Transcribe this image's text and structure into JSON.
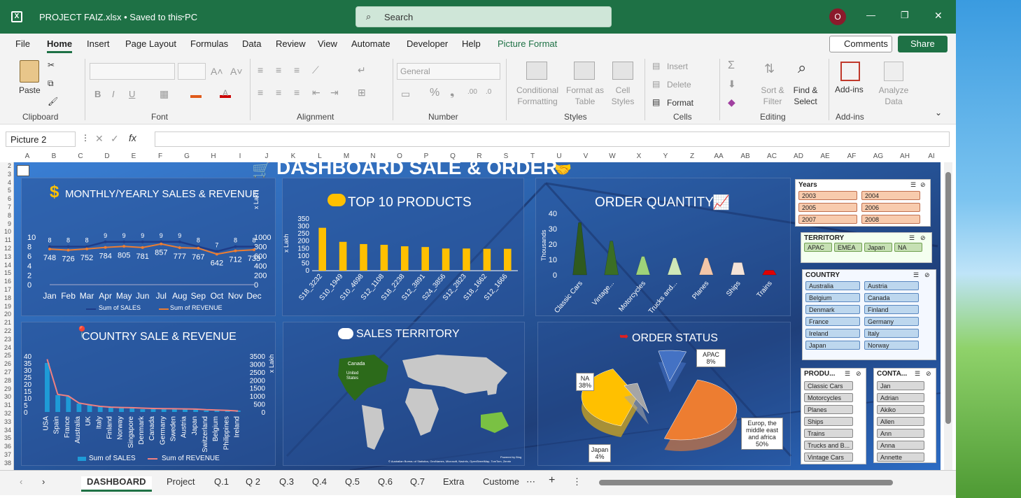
{
  "window": {
    "title": "PROJECT FAIZ.xlsx  •  Saved to this PC",
    "search_placeholder": "Search",
    "avatar": "O",
    "minimize": "—",
    "restore": "❐",
    "close": "✕"
  },
  "menu": [
    "File",
    "Home",
    "Insert",
    "Page Layout",
    "Formulas",
    "Data",
    "Review",
    "View",
    "Automate",
    "Developer",
    "Help",
    "Picture Format"
  ],
  "menu_right": {
    "comments": "Comments",
    "share": "Share"
  },
  "ribbon": {
    "clipboard": {
      "paste": "Paste",
      "group": "Clipboard"
    },
    "font": {
      "group": "Font",
      "bold": "B",
      "italic": "I",
      "underline": "U"
    },
    "alignment": {
      "group": "Alignment"
    },
    "number": {
      "group": "Number",
      "format": "General",
      "percent": "%"
    },
    "styles": {
      "group": "Styles",
      "conditional": "Conditional Formatting",
      "format_as": "Format as Table",
      "cell_styles": "Cell Styles"
    },
    "cells": {
      "group": "Cells",
      "insert": "Insert",
      "delete": "Delete",
      "format": "Format"
    },
    "editing": {
      "group": "Editing",
      "sort": "Sort & Filter",
      "find": "Find & Select"
    },
    "addins": {
      "group": "Add-ins",
      "addins": "Add-ins",
      "analyze": "Analyze Data"
    }
  },
  "formula_bar": {
    "name_box": "Picture 2",
    "fx": "fx"
  },
  "columns": [
    "A",
    "B",
    "C",
    "D",
    "E",
    "F",
    "G",
    "H",
    "I",
    "J",
    "K",
    "L",
    "M",
    "N",
    "O",
    "P",
    "Q",
    "R",
    "S",
    "T",
    "U",
    "V",
    "W",
    "X",
    "Y",
    "Z",
    "AA",
    "AB",
    "AC",
    "AD",
    "AE",
    "AF",
    "AG",
    "AH",
    "AI"
  ],
  "rows": [
    "2",
    "3",
    "4",
    "5",
    "6",
    "7",
    "8",
    "9",
    "10",
    "11",
    "12",
    "13",
    "14",
    "15",
    "16",
    "17",
    "18",
    "19",
    "20",
    "21",
    "22",
    "23",
    "24",
    "25",
    "26",
    "27",
    "28",
    "29",
    "30",
    "31",
    "32",
    "33",
    "34",
    "35",
    "36",
    "37",
    "38"
  ],
  "dashboard": {
    "title": "DASHBOARD SALE & ORDER",
    "monthly": {
      "title": "MONTHLY/YEARLY SALES & REVENUE",
      "unit": "x Lakh",
      "legend_sales": "Sum of SALES",
      "legend_revenue": "Sum of REVENUE",
      "left_ticks": [
        "10",
        "8",
        "6",
        "4",
        "2",
        "0"
      ],
      "right_ticks": [
        "1000",
        "800",
        "600",
        "400",
        "200",
        "0"
      ]
    },
    "top10": {
      "title": "TOP 10 PRODUCTS",
      "unit": "x Lakh",
      "ticks": [
        "350",
        "300",
        "250",
        "200",
        "150",
        "100",
        "50",
        "0"
      ]
    },
    "order_qty": {
      "title": "ORDER QUANTITY",
      "unit": "Thousands",
      "ticks": [
        "40",
        "30",
        "20",
        "10",
        "0"
      ]
    },
    "country": {
      "title": "COUNTRY SALE & REVENUE",
      "unit": "x Lakh",
      "legend_sales": "Sum of SALES",
      "legend_revenue": "Sum of REVENUE",
      "left_ticks": [
        "40",
        "35",
        "30",
        "25",
        "20",
        "15",
        "10",
        "5",
        "0"
      ],
      "right_ticks": [
        "3500",
        "3000",
        "2500",
        "2000",
        "1500",
        "1000",
        "500",
        "0"
      ]
    },
    "territory": {
      "title": "SALES TERRITORY",
      "map_label_canada": "Canada",
      "map_label_us": "United States",
      "credit": "© Australian Bureau of Statistics, GeoNames, Microsoft, Navinfo, OpenStreetMap, TomTom, Zenrin",
      "powered": "Powered by Bing"
    },
    "order_status": {
      "title": "ORDER STATUS"
    }
  },
  "chart_data": [
    {
      "type": "line",
      "title": "MONTHLY/YEARLY SALES & REVENUE",
      "categories": [
        "Jan",
        "Feb",
        "Mar",
        "Apr",
        "May",
        "Jun",
        "Jul",
        "Aug",
        "Sep",
        "Oct",
        "Nov",
        "Dec"
      ],
      "series": [
        {
          "name": "Sum of SALES",
          "values": [
            8,
            8,
            8,
            9,
            9,
            9,
            9,
            9,
            8,
            7,
            8,
            8
          ]
        },
        {
          "name": "Sum of REVENUE",
          "values": [
            748,
            726,
            752,
            784,
            805,
            781,
            857,
            777,
            767,
            642,
            712,
            733
          ]
        }
      ],
      "ylabel": "x Lakh",
      "ylim": [
        0,
        10
      ],
      "y2lim": [
        0,
        1000
      ],
      "legend": "bottom"
    },
    {
      "type": "bar",
      "title": "TOP 10 PRODUCTS",
      "categories": [
        "S18_3232",
        "S10_1949",
        "S10_4698",
        "S12_1108",
        "S18_2238",
        "S12_3891",
        "S24_3856",
        "S12_2823",
        "S18_1662",
        "S12_1666"
      ],
      "values": [
        290,
        195,
        180,
        175,
        165,
        160,
        150,
        150,
        148,
        148
      ],
      "ylabel": "x Lakh",
      "ylim": [
        0,
        350
      ]
    },
    {
      "type": "bar",
      "title": "ORDER QUANTITY",
      "categories": [
        "Classic Cars",
        "Vintage...",
        "Motorcycles",
        "Trucks and...",
        "Planes",
        "Ships",
        "Trains"
      ],
      "values": [
        34,
        22,
        12,
        11,
        11,
        8,
        3
      ],
      "ylabel": "Thousands",
      "ylim": [
        0,
        40
      ]
    },
    {
      "type": "bar",
      "title": "COUNTRY SALE & REVENUE",
      "categories": [
        "USA",
        "Spain",
        "France",
        "Australia",
        "UK",
        "Italy",
        "Finland",
        "Norway",
        "Singapore",
        "Denmark",
        "Canada",
        "Germany",
        "Sweden",
        "Austria",
        "Japan",
        "Switzerland",
        "Belgium",
        "Philippines",
        "Ireland"
      ],
      "series": [
        {
          "name": "Sum of SALES",
          "values": [
            35,
            12,
            11,
            6,
            5,
            4,
            3,
            3,
            3,
            2,
            2,
            2,
            2,
            2,
            2,
            1,
            1,
            1,
            1
          ]
        },
        {
          "name": "Sum of REVENUE",
          "values": [
            3300,
            1100,
            1000,
            560,
            450,
            350,
            300,
            280,
            270,
            240,
            220,
            210,
            200,
            190,
            180,
            140,
            120,
            100,
            60
          ]
        }
      ],
      "ylabel": "x Lakh",
      "ylim": [
        0,
        40
      ],
      "y2lim": [
        0,
        3500
      ],
      "legend": "bottom"
    },
    {
      "type": "pie",
      "title": "ORDER STATUS",
      "categories": [
        "Europ, the middle east and africa",
        "NA",
        "Japan",
        "APAC"
      ],
      "values": [
        50,
        38,
        4,
        8
      ],
      "labels": [
        "Europ, the middle east and africa 50%",
        "NA 38%",
        "Japan 4%",
        "APAC 8%"
      ],
      "colors": [
        "#ed7d31",
        "#ffc000",
        "#a5a5a5",
        "#4472c4"
      ]
    }
  ],
  "slicers": {
    "years": {
      "title": "Years",
      "items": [
        "2003",
        "2004",
        "2005",
        "2006",
        "2007",
        "2008"
      ]
    },
    "territory": {
      "title": "TERRITORY",
      "items": [
        "APAC",
        "EMEA",
        "Japan",
        "NA"
      ]
    },
    "country": {
      "title": "COUNTRY",
      "items": [
        "Australia",
        "Austria",
        "Belgium",
        "Canada",
        "Denmark",
        "Finland",
        "France",
        "Germany",
        "Ireland",
        "Italy",
        "Japan",
        "Norway"
      ]
    },
    "product": {
      "title": "PRODU...",
      "items": [
        "Classic Cars",
        "Motorcycles",
        "Planes",
        "Ships",
        "Trains",
        "Trucks and B...",
        "Vintage Cars"
      ]
    },
    "contact": {
      "title": "CONTA...",
      "items": [
        "Jan",
        "Adrian",
        "Akiko",
        "Allen",
        "Ann",
        "Anna",
        "Annette"
      ]
    }
  },
  "sheet_tabs": [
    "DASHBOARD",
    "Project",
    "Q.1",
    "Q 2",
    "Q.3",
    "Q.4",
    "Q.5",
    "Q.6",
    "Q.7",
    "Extra",
    "Custome"
  ],
  "colors": {
    "excel_green": "#1e7145",
    "sales": "#1f3c88",
    "revenue": "#ed7d31",
    "bar": "#ffc000",
    "country_bar": "#1e9bd7",
    "country_line": "#f08080"
  }
}
